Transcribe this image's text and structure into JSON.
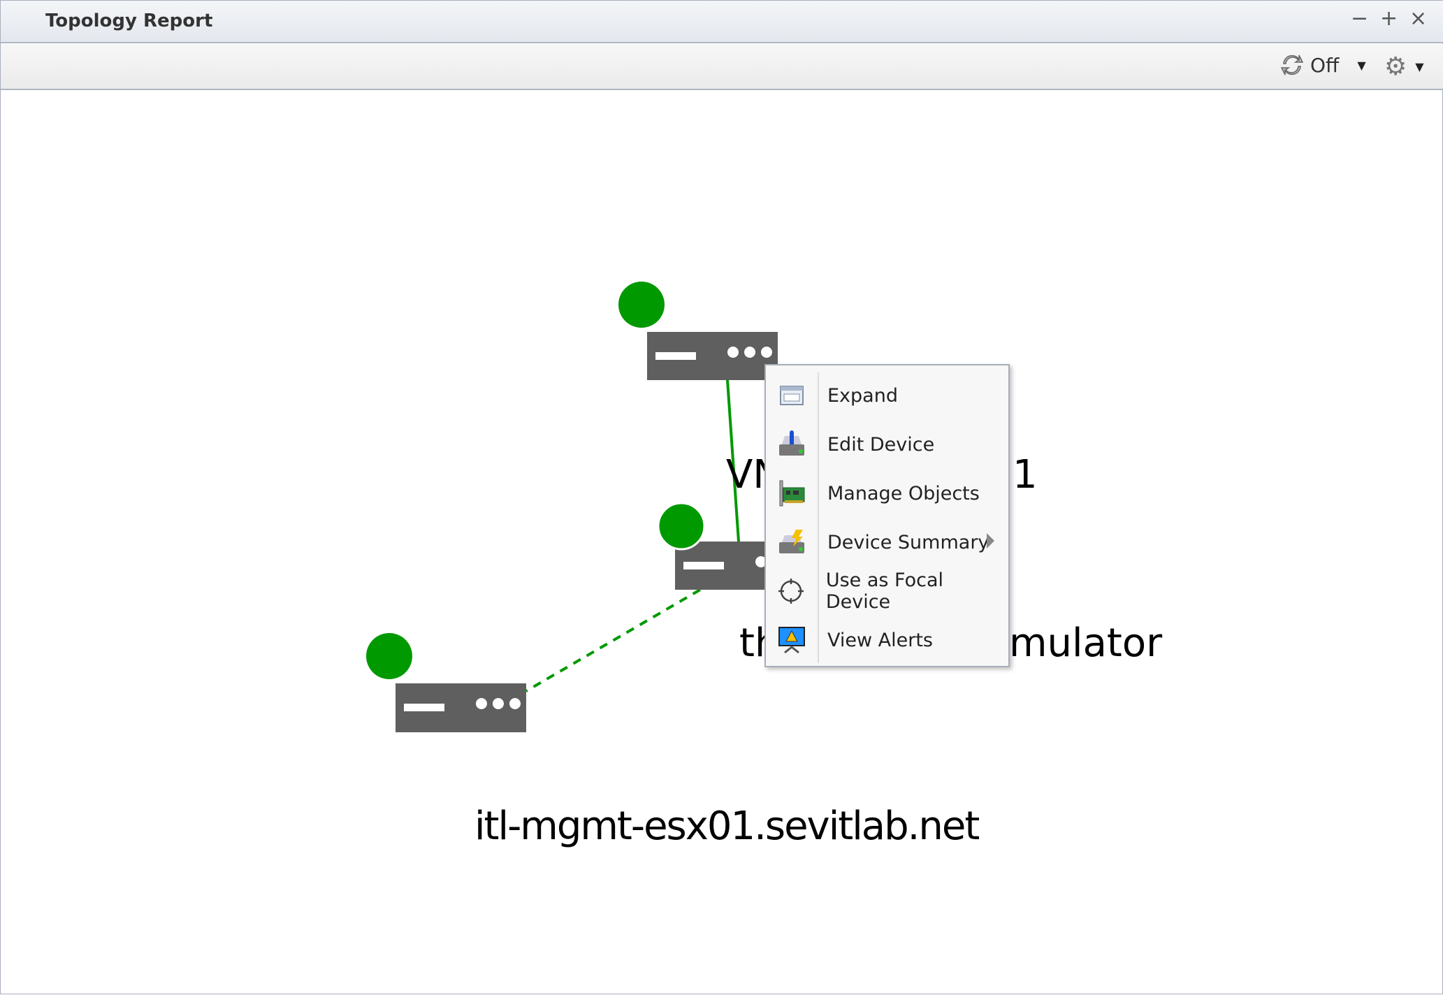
{
  "window": {
    "title": "Topology Report",
    "controls": [
      "minimize",
      "maximize",
      "close"
    ]
  },
  "toolbar": {
    "refresh_label": "Off",
    "refresh_icon": "refresh-icon",
    "settings_icon": "gear-icon"
  },
  "topology": {
    "status_color": "#009900",
    "link_color": "#009900",
    "device_color": "#5f5f5f",
    "nodes": [
      {
        "label_parts": [
          "VN",
          "1"
        ]
      },
      {
        "label_parts": [
          "th",
          "mulator"
        ]
      },
      {
        "label": "itl-mgmt-esx01.sevitlab.net"
      }
    ],
    "links": [
      {
        "from": 0,
        "to": 1,
        "style": "solid"
      },
      {
        "from": 1,
        "to": 2,
        "style": "dashed"
      }
    ]
  },
  "context_menu": {
    "items": [
      {
        "label": "Expand",
        "icon": "window-icon"
      },
      {
        "label": "Edit Device",
        "icon": "edit-device-icon"
      },
      {
        "label": "Manage Objects",
        "icon": "network-card-icon"
      },
      {
        "label": "Device Summary",
        "icon": "device-summary-icon",
        "submenu": true
      },
      {
        "label": "Use as Focal Device",
        "icon": "crosshair-icon"
      },
      {
        "label": "View Alerts",
        "icon": "alert-monitor-icon"
      }
    ]
  }
}
